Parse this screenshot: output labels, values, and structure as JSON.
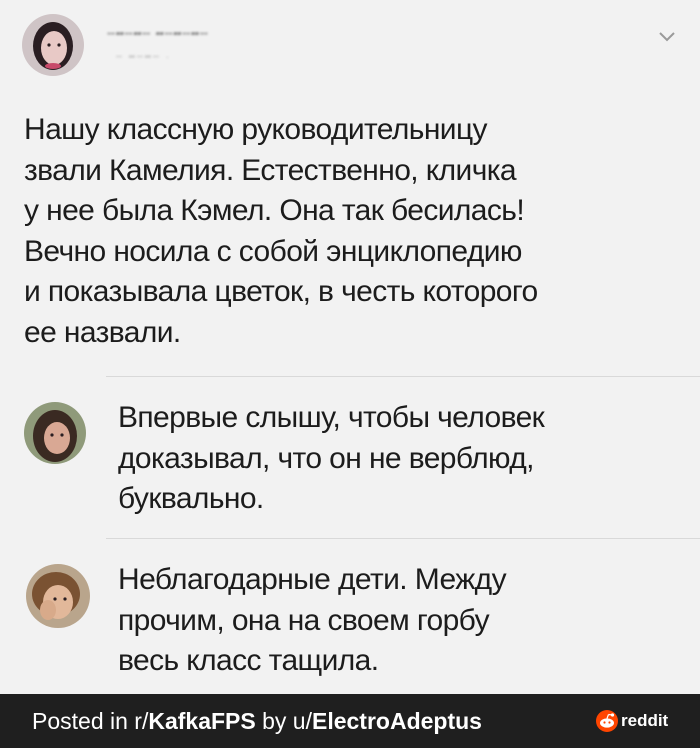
{
  "post": {
    "author_name": "╌╍╌╍╌ ╍╌╍╌╍╌",
    "author_handle": "╌ ╍╌╍╌ ·",
    "text_lines": [
      "Нашу классную руководительницу",
      "звали Камелия. Естественно, кличка",
      "у нее была Кэмел. Она так бесилась!",
      "Вечно носила с собой энциклопедию",
      "и показывала цветок, в честь которого",
      "ее назвали."
    ]
  },
  "replies": [
    {
      "text_lines": [
        "Впервые слышу, чтобы человек",
        "доказывал, что он не верблюд,",
        "буквально."
      ]
    },
    {
      "text_lines": [
        "Неблагодарные дети. Между",
        "прочим, она на своем горбу",
        "весь класс тащила."
      ]
    }
  ],
  "footer": {
    "posted_in": "Posted in r/",
    "subreddit": "KafkaFPS",
    "by": " by u/",
    "username": "ElectroAdeptus",
    "brand": "reddit"
  },
  "colors": {
    "background": "#f2f2f2",
    "footer_bg": "#1f1f1f",
    "reddit_orange": "#ff4500"
  },
  "icons": {
    "expand": "chevron-down-icon",
    "brand": "reddit-icon"
  }
}
